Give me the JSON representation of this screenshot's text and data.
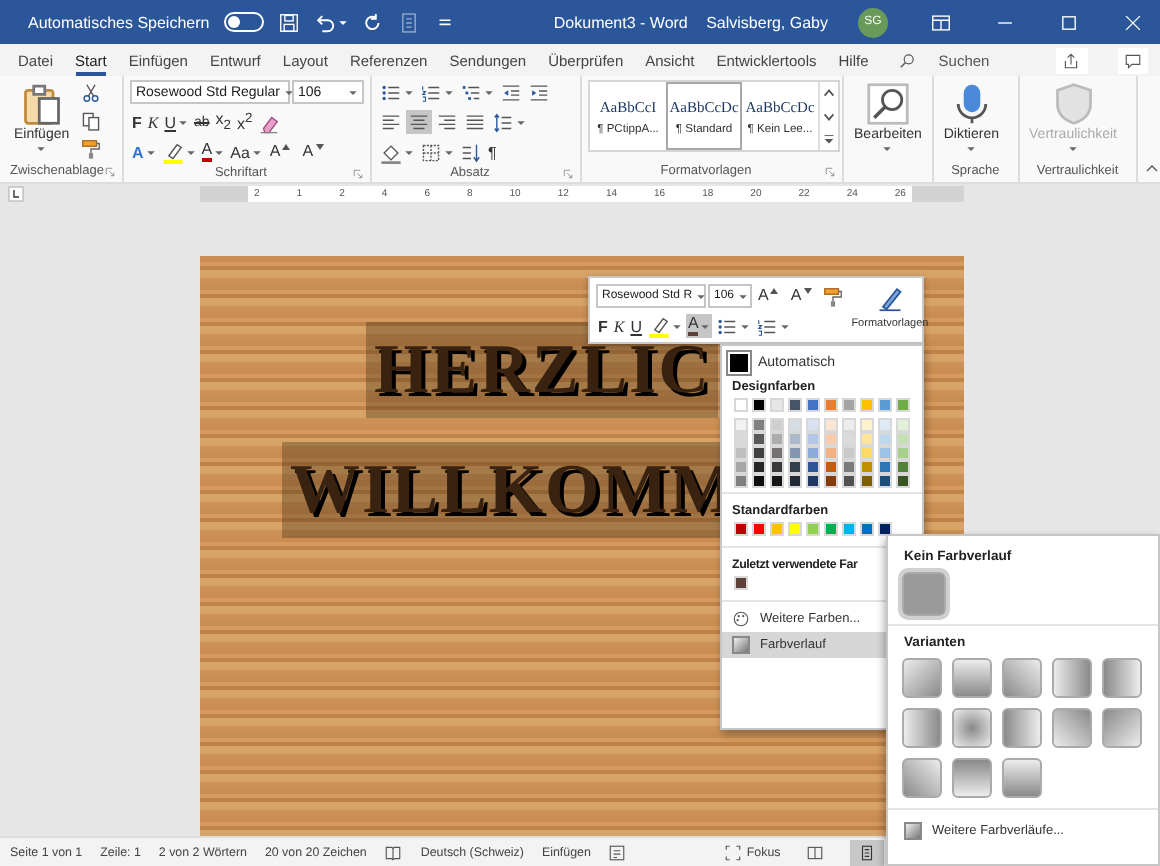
{
  "title_bar": {
    "autosave_label": "Automatisches Speichern",
    "autosave_on": false,
    "title": "Dokument3 - Word",
    "user": "Salvisberg, Gaby",
    "avatar": "SG"
  },
  "tabs": [
    {
      "label": "Datei",
      "selected": false
    },
    {
      "label": "Start",
      "selected": true
    },
    {
      "label": "Einfügen",
      "selected": false
    },
    {
      "label": "Entwurf",
      "selected": false
    },
    {
      "label": "Layout",
      "selected": false
    },
    {
      "label": "Referenzen",
      "selected": false
    },
    {
      "label": "Sendungen",
      "selected": false
    },
    {
      "label": "Überprüfen",
      "selected": false
    },
    {
      "label": "Ansicht",
      "selected": false
    },
    {
      "label": "Entwicklertools",
      "selected": false
    },
    {
      "label": "Hilfe",
      "selected": false
    }
  ],
  "search": {
    "placeholder": "Suchen"
  },
  "ribbon": {
    "clipboard": {
      "paste": "Einfügen",
      "label": "Zwischenablage"
    },
    "font": {
      "name": "Rosewood Std Regular",
      "size": "106",
      "label": "Schriftart",
      "row_1": [
        {
          "kind": "bold",
          "label": "F",
          "dropdown": false,
          "pressed": false
        },
        {
          "kind": "italic",
          "label": "K",
          "dropdown": false,
          "pressed": false
        },
        {
          "kind": "underline",
          "label": "U",
          "dropdown": true,
          "pressed": false
        },
        {
          "kind": "strike",
          "label": "ab",
          "dropdown": false,
          "pressed": false
        },
        {
          "kind": "sub",
          "label": "x$_{2}$",
          "dropdown": false,
          "pressed": false
        },
        {
          "kind": "sup",
          "label": "x$^{2}$",
          "dropdown": false,
          "pressed": false
        },
        {
          "kind": "clear",
          "dropdown": false,
          "pressed": false
        }
      ],
      "row_2": [
        {
          "kind": "effect",
          "label": "A",
          "dropdown": true,
          "pressed": false
        },
        {
          "kind": "highlight",
          "dropdown": true,
          "pressed": false
        },
        {
          "kind": "fontcolor",
          "label": "A",
          "dropdown": true,
          "pressed": false
        },
        {
          "kind": "case",
          "label": "Aa",
          "dropdown": true,
          "pressed": false
        },
        {
          "kind": "grow",
          "label": "A",
          "dropdown": false,
          "pressed": false
        },
        {
          "kind": "shrink",
          "label": "A",
          "dropdown": false,
          "pressed": false
        }
      ]
    },
    "paragraph": {
      "label": "Absatz",
      "row_1": [
        {
          "kind": "bullets",
          "dropdown": true,
          "pressed": false
        },
        {
          "kind": "numbering",
          "dropdown": true,
          "pressed": false
        },
        {
          "kind": "multilevel",
          "dropdown": true,
          "pressed": false
        },
        {
          "kind": "outdent",
          "dropdown": false,
          "pressed": false
        },
        {
          "kind": "indent",
          "dropdown": false,
          "pressed": false
        }
      ],
      "row_2": [
        {
          "kind": "left",
          "dropdown": false,
          "pressed": false
        },
        {
          "kind": "center",
          "dropdown": false,
          "pressed": true
        },
        {
          "kind": "right",
          "dropdown": false,
          "pressed": false
        },
        {
          "kind": "justify",
          "dropdown": false,
          "pressed": false
        },
        {
          "kind": "spacing",
          "dropdown": true,
          "pressed": false
        }
      ],
      "row_3": [
        {
          "kind": "shading",
          "dropdown": true,
          "pressed": false
        },
        {
          "kind": "borders",
          "dropdown": true,
          "pressed": false
        },
        {
          "kind": "sort",
          "dropdown": false,
          "pressed": false
        },
        {
          "kind": "pilcrow",
          "label": "¶",
          "dropdown": false,
          "pressed": false
        }
      ]
    },
    "styles": {
      "label": "Formatvorlagen",
      "items": [
        {
          "preview": "AaBbCcI",
          "name": "¶ PCtippA...",
          "selected": false
        },
        {
          "preview": "AaBbCcDc",
          "name": "¶ Standard",
          "selected": true
        },
        {
          "preview": "AaBbCcDc",
          "name": "¶ Kein Lee...",
          "selected": false
        }
      ]
    },
    "editing": {
      "button": "Bearbeiten"
    },
    "voice": {
      "button": "Diktieren",
      "label": "Sprache"
    },
    "sensitivity": {
      "button": "Vertraulichkeit",
      "label": "Vertraulichkeit",
      "disabled": true
    }
  },
  "ruler": {
    "labels": [
      "2",
      "1",
      "2",
      "4",
      "6",
      "8",
      "10",
      "12",
      "14",
      "16",
      "18",
      "20",
      "22",
      "24",
      "26"
    ]
  },
  "document": {
    "lines": [
      "HERZLIC",
      "WILLKOMM"
    ],
    "selected": true
  },
  "mini_toolbar": {
    "font": "Rosewood Std R",
    "size": "106",
    "styles_button": "Formatvorlagen",
    "row_1": [
      {
        "kind": "grow",
        "label": "A",
        "dropdown": false,
        "pressed": false
      },
      {
        "kind": "shrink",
        "label": "A",
        "dropdown": false,
        "pressed": false
      },
      {
        "kind": "painter",
        "dropdown": false,
        "pressed": false
      }
    ],
    "row_2": [
      {
        "kind": "bold",
        "label": "F",
        "dropdown": false,
        "pressed": false
      },
      {
        "kind": "italic",
        "label": "K",
        "dropdown": false,
        "pressed": false
      },
      {
        "kind": "underline",
        "label": "U",
        "dropdown": false,
        "pressed": false
      },
      {
        "kind": "highlight",
        "dropdown": true,
        "pressed": false
      },
      {
        "kind": "fontcolor",
        "label": "A",
        "dropdown": true,
        "pressed": true
      },
      {
        "kind": "bullets",
        "dropdown": true,
        "pressed": false
      },
      {
        "kind": "numbering",
        "dropdown": true,
        "pressed": false
      }
    ]
  },
  "color_menu": {
    "automatic": "Automatisch",
    "theme_title": "Designfarben",
    "theme_row": [
      {
        "color": "#ffffff"
      },
      {
        "color": "#000000"
      },
      {
        "color": "#e7e6e6"
      },
      {
        "color": "#44546a"
      },
      {
        "color": "#4472c4"
      },
      {
        "color": "#ed7d31"
      },
      {
        "color": "#a5a5a5"
      },
      {
        "color": "#ffc000"
      },
      {
        "color": "#5b9bd5"
      },
      {
        "color": "#70ad47"
      }
    ],
    "shade_rows": [
      [
        {
          "color": "#f2f2f2"
        },
        {
          "color": "#7f7f7f"
        },
        {
          "color": "#d0cece"
        },
        {
          "color": "#d6dce4"
        },
        {
          "color": "#d9e2f3"
        },
        {
          "color": "#fbe5d5"
        },
        {
          "color": "#ededed"
        },
        {
          "color": "#fff2cc"
        },
        {
          "color": "#deebf6"
        },
        {
          "color": "#e2efd9"
        }
      ],
      [
        {
          "color": "#d9d9d9"
        },
        {
          "color": "#595959"
        },
        {
          "color": "#aeabab"
        },
        {
          "color": "#adb9ca"
        },
        {
          "color": "#b4c6e7"
        },
        {
          "color": "#f7cbac"
        },
        {
          "color": "#dbdbdb"
        },
        {
          "color": "#fee599"
        },
        {
          "color": "#bdd7ee"
        },
        {
          "color": "#c5e0b3"
        }
      ],
      [
        {
          "color": "#bfbfbf"
        },
        {
          "color": "#404040"
        },
        {
          "color": "#757171"
        },
        {
          "color": "#8497b0"
        },
        {
          "color": "#8eaadb"
        },
        {
          "color": "#f4b183"
        },
        {
          "color": "#c9c9c9"
        },
        {
          "color": "#ffd965"
        },
        {
          "color": "#9cc3e5"
        },
        {
          "color": "#a8d08d"
        }
      ],
      [
        {
          "color": "#a6a6a6"
        },
        {
          "color": "#262626"
        },
        {
          "color": "#3a3838"
        },
        {
          "color": "#333f4f"
        },
        {
          "color": "#2f5496"
        },
        {
          "color": "#c55a11"
        },
        {
          "color": "#7b7b7b"
        },
        {
          "color": "#bf9000"
        },
        {
          "color": "#2e75b5"
        },
        {
          "color": "#538135"
        }
      ],
      [
        {
          "color": "#808080"
        },
        {
          "color": "#0d0d0d"
        },
        {
          "color": "#171616"
        },
        {
          "color": "#222a35"
        },
        {
          "color": "#1f3864"
        },
        {
          "color": "#833c0b"
        },
        {
          "color": "#525252"
        },
        {
          "color": "#7f6000"
        },
        {
          "color": "#1e4e79"
        },
        {
          "color": "#375623"
        }
      ]
    ],
    "standard_title": "Standardfarben",
    "standard": [
      {
        "color": "#c00000"
      },
      {
        "color": "#ff0000"
      },
      {
        "color": "#ffc000"
      },
      {
        "color": "#ffff00"
      },
      {
        "color": "#92d050"
      },
      {
        "color": "#00b050"
      },
      {
        "color": "#00b0f0"
      },
      {
        "color": "#0070c0"
      },
      {
        "color": "#002060"
      }
    ],
    "recent_title": "Zuletzt verwendete Far",
    "recent": [
      {
        "color": "#5d4037"
      }
    ],
    "items": [
      {
        "kind": "palette",
        "label": "Weitere Farben...",
        "selected": false
      },
      {
        "kind": "gradient",
        "label": "Farbverlauf",
        "selected": true
      }
    ]
  },
  "gradient_menu": {
    "none_title": "Kein Farbverlauf",
    "none_tile": {
      "selected": true
    },
    "variants_title": "Varianten",
    "variants": [
      {
        "kind": "diag-tl"
      },
      {
        "kind": "down"
      },
      {
        "kind": "diag-tr"
      },
      {
        "kind": "right"
      },
      {
        "kind": "left"
      },
      {
        "kind": "right"
      },
      {
        "kind": "center"
      },
      {
        "kind": "left"
      },
      {
        "kind": "diag-bl"
      },
      {
        "kind": "diag-br"
      },
      {
        "kind": "diag-tr"
      },
      {
        "kind": "up"
      },
      {
        "kind": "down"
      }
    ],
    "more": "Weitere Farbverläufe..."
  },
  "status_bar": {
    "items": [
      {
        "kind": "text",
        "label": "Seite 1 von 1"
      },
      {
        "kind": "text",
        "label": "Zeile: 1"
      },
      {
        "kind": "text",
        "label": "2 von 2 Wörtern"
      },
      {
        "kind": "text",
        "label": "20 von 20 Zeichen"
      },
      {
        "kind": "proofing"
      },
      {
        "kind": "text",
        "label": "Deutsch (Schweiz)"
      },
      {
        "kind": "text",
        "label": "Einfügen"
      },
      {
        "kind": "macro"
      }
    ],
    "focus": "Fokus",
    "views": [
      {
        "kind": "read",
        "selected": false
      },
      {
        "kind": "print",
        "selected": true
      }
    ]
  }
}
